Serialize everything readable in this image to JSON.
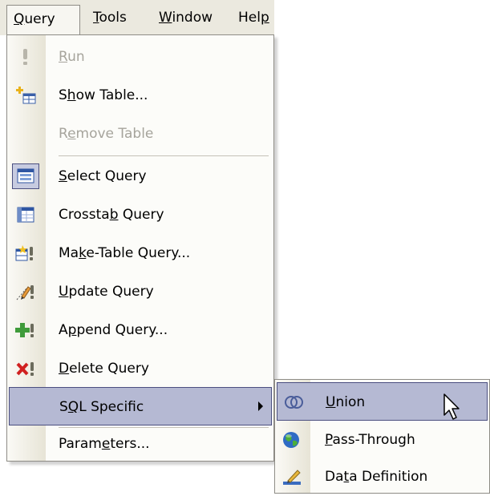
{
  "menubar": {
    "items": [
      {
        "label": "Query",
        "mnemonic_index": 0,
        "open": true
      },
      {
        "label": "Tools",
        "mnemonic_index": 0
      },
      {
        "label": "Window",
        "mnemonic_index": 0
      },
      {
        "label": "Help",
        "mnemonic_index": 3
      }
    ]
  },
  "query_menu": {
    "items": [
      {
        "id": "run",
        "label": "Run",
        "mnemonic_index": 0,
        "disabled": true,
        "icon": "exclamation-icon"
      },
      {
        "id": "show-table",
        "label": "Show Table...",
        "mnemonic_index": 1,
        "icon": "show-table-icon"
      },
      {
        "id": "remove-table",
        "label": "Remove Table",
        "mnemonic_index": 1,
        "disabled": true,
        "icon": null
      },
      {
        "id": "select-query",
        "label": "Select Query",
        "mnemonic_index": 0,
        "icon": "select-query-icon",
        "checked": true
      },
      {
        "id": "crosstab-query",
        "label": "Crosstab Query",
        "mnemonic_index": 7,
        "icon": "crosstab-query-icon"
      },
      {
        "id": "make-table-query",
        "label": "Make-Table Query...",
        "mnemonic_index": 2,
        "icon": "make-table-query-icon"
      },
      {
        "id": "update-query",
        "label": "Update Query",
        "mnemonic_index": 0,
        "icon": "update-query-icon"
      },
      {
        "id": "append-query",
        "label": "Append Query...",
        "mnemonic_index": 1,
        "icon": "append-query-icon"
      },
      {
        "id": "delete-query",
        "label": "Delete Query",
        "mnemonic_index": 0,
        "icon": "delete-query-icon"
      },
      {
        "id": "sql-specific",
        "label": "SQL Specific",
        "mnemonic_index": 1,
        "icon": null,
        "submenu": true,
        "highlighted": true
      },
      {
        "id": "parameters",
        "label": "Parameters...",
        "mnemonic_index": 5,
        "icon": null
      }
    ]
  },
  "sql_submenu": {
    "items": [
      {
        "id": "union",
        "label": "Union",
        "mnemonic_index": 0,
        "icon": "union-icon",
        "highlighted": true
      },
      {
        "id": "pass-through",
        "label": "Pass-Through",
        "mnemonic_index": 0,
        "icon": "globe-icon"
      },
      {
        "id": "data-definition",
        "label": "Data Definition",
        "mnemonic_index": 2,
        "icon": "data-definition-icon"
      }
    ]
  },
  "colors": {
    "menubar_bg": "#ebe9df",
    "menu_bg": "#fcfcf9",
    "highlight_bg": "#b5b9d3",
    "highlight_border": "#4b4f80",
    "disabled_text": "#a6a49c"
  }
}
